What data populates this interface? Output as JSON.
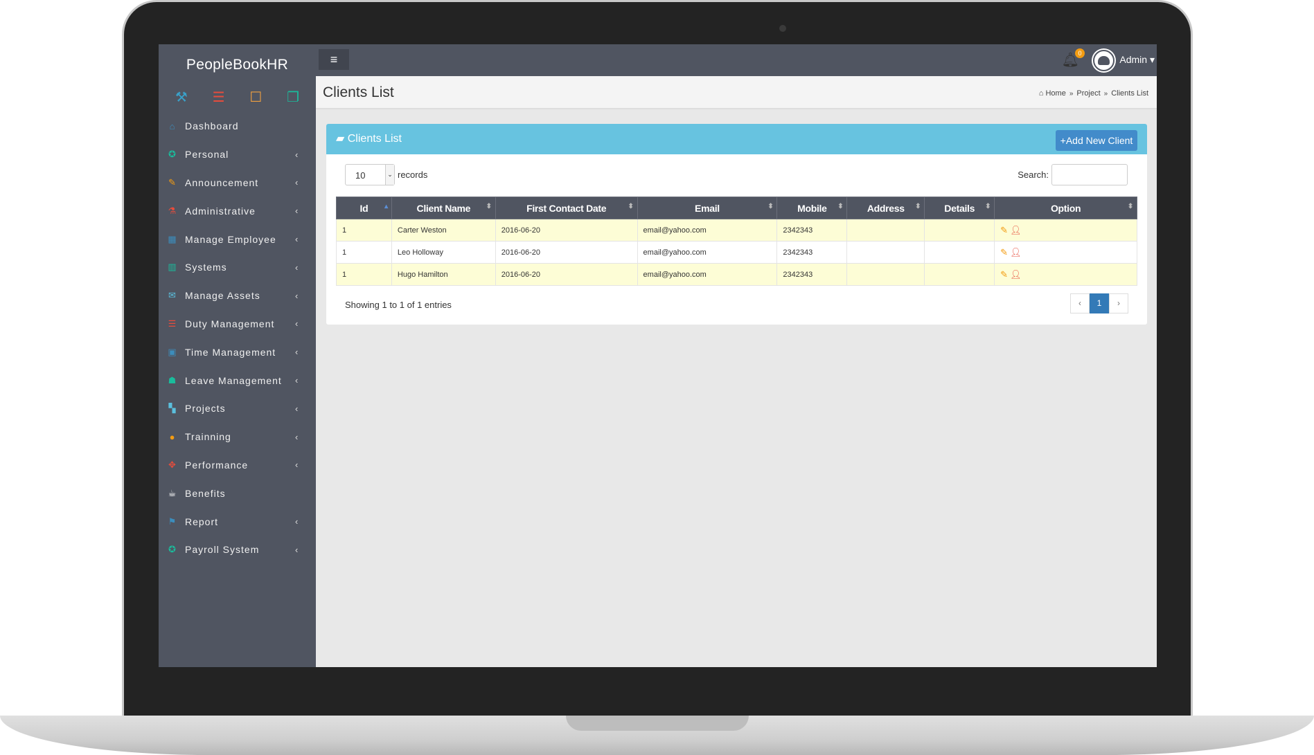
{
  "app": {
    "name": "PeopleBookHR"
  },
  "quick_icons": [
    {
      "icon": "hammer-icon",
      "color": "#3aa0c8"
    },
    {
      "icon": "list-icon",
      "color": "#e74c3c"
    },
    {
      "icon": "square-icon",
      "color": "#f0a040"
    },
    {
      "icon": "windows-icon",
      "color": "#1abc9c"
    }
  ],
  "sidebar": {
    "items": [
      {
        "label": "Dashboard",
        "icon": "home-icon",
        "color": "#3c8dbc",
        "chevron": false
      },
      {
        "label": "Personal",
        "icon": "award-icon",
        "color": "#1abc9c",
        "chevron": true
      },
      {
        "label": "Announcement",
        "icon": "pencil-icon",
        "color": "#f39c12",
        "chevron": true
      },
      {
        "label": "Administrative",
        "icon": "flask-icon",
        "color": "#e74c3c",
        "chevron": true
      },
      {
        "label": "Manage Employee",
        "icon": "table-icon",
        "color": "#3c8dbc",
        "chevron": true
      },
      {
        "label": "Systems",
        "icon": "bar-chart-icon",
        "color": "#1abc9c",
        "chevron": true
      },
      {
        "label": "Manage Assets",
        "icon": "envelope-icon",
        "color": "#5bc0de",
        "chevron": true
      },
      {
        "label": "Duty Management",
        "icon": "list-icon",
        "color": "#e74c3c",
        "chevron": true
      },
      {
        "label": "Time Management",
        "icon": "picture-icon",
        "color": "#3c8dbc",
        "chevron": true
      },
      {
        "label": "Leave Management",
        "icon": "users-icon",
        "color": "#1abc9c",
        "chevron": true
      },
      {
        "label": "Projects",
        "icon": "map-icon",
        "color": "#5bc0de",
        "chevron": true
      },
      {
        "label": "Trainning",
        "icon": "comment-icon",
        "color": "#f39c12",
        "chevron": true
      },
      {
        "label": "Performance",
        "icon": "move-icon",
        "color": "#e74c3c",
        "chevron": true
      },
      {
        "label": "Benefits",
        "icon": "coffee-icon",
        "color": "#ffffff",
        "chevron": false
      },
      {
        "label": "Report",
        "icon": "flag-icon",
        "color": "#3c8dbc",
        "chevron": true
      },
      {
        "label": "Payroll System",
        "icon": "award-icon",
        "color": "#1abc9c",
        "chevron": true
      }
    ]
  },
  "topbar": {
    "menu_icon": "≡",
    "notifications": "0",
    "user": "Admin ▾"
  },
  "page": {
    "title": "Clients List",
    "breadcrumb": [
      "Home",
      "Project",
      "Clients List"
    ],
    "sep": "»"
  },
  "panel": {
    "title": "Clients List",
    "add_button": "+Add New Client",
    "length_value": "10",
    "length_label": "records",
    "search_label": "Search:",
    "search_value": "",
    "info": "Showing 1 to 1 of 1 entries",
    "pages": [
      "‹",
      "1",
      "›"
    ]
  },
  "table": {
    "columns": [
      "Id",
      "Client Name",
      "First Contact Date",
      "Email",
      "Mobile",
      "Address",
      "Details",
      "Option"
    ],
    "rows": [
      [
        "1",
        "Carter Weston",
        "2016-06-20",
        "email@yahoo.com",
        "2342343",
        "",
        ""
      ],
      [
        "1",
        "Leo Holloway",
        "2016-06-20",
        "email@yahoo.com",
        "2342343",
        "",
        ""
      ],
      [
        "1",
        "Hugo Hamilton",
        "2016-06-20",
        "email@yahoo.com",
        "2342343",
        "",
        ""
      ]
    ]
  }
}
